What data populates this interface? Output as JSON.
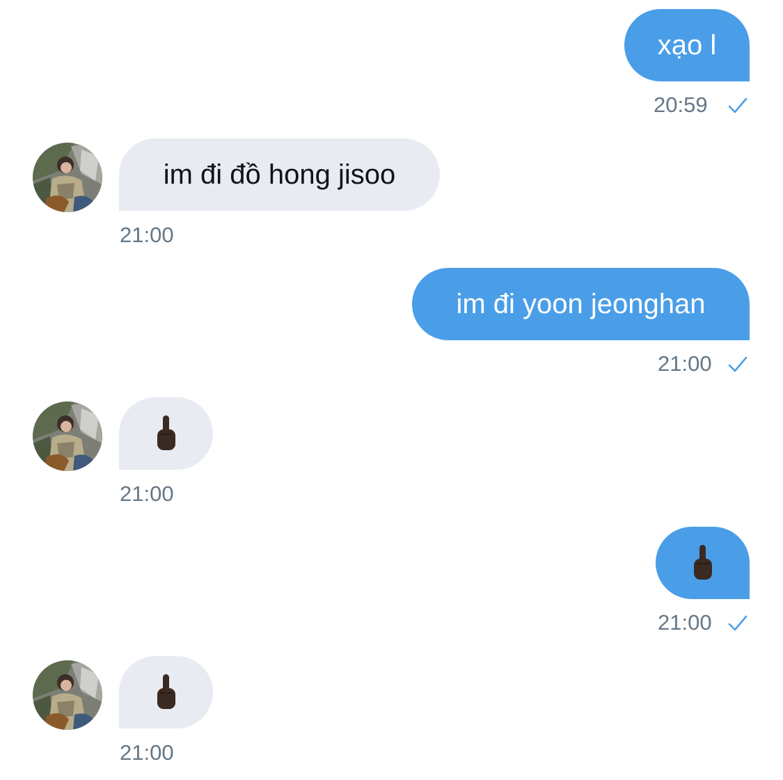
{
  "conversation": {
    "messages": [
      {
        "direction": "outgoing",
        "text": "xạo l",
        "time": "20:59",
        "status_icon": "sent-check-icon"
      },
      {
        "direction": "incoming",
        "text": "im đi đồ hong jisoo",
        "time": "21:00"
      },
      {
        "direction": "outgoing",
        "text": "im đi yoon jeonghan",
        "time": "21:00",
        "status_icon": "sent-check-icon"
      },
      {
        "direction": "incoming",
        "emoji": "middle-finger-emoji",
        "time": "21:00"
      },
      {
        "direction": "outgoing",
        "emoji": "middle-finger-emoji",
        "time": "21:00",
        "status_icon": "sent-check-icon"
      },
      {
        "direction": "incoming",
        "emoji": "middle-finger-emoji",
        "time": "21:00"
      }
    ]
  },
  "colors": {
    "outgoing_bubble": "#4a9ee8",
    "incoming_bubble": "#e8ebf1",
    "timestamp": "#657786",
    "check": "#4a9ee8",
    "emoji_skin": "#3b2a22"
  }
}
